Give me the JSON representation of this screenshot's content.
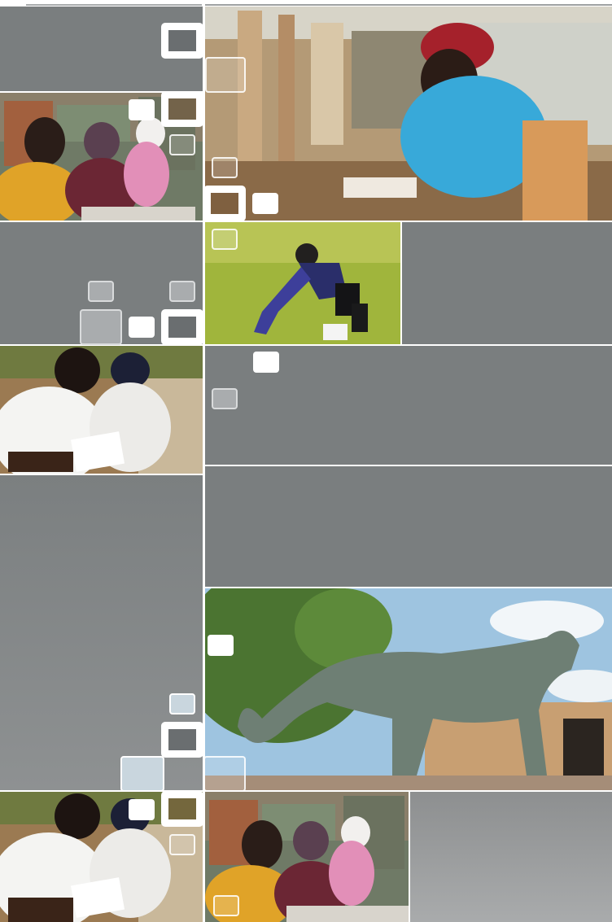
{
  "page": {
    "background": "#ffffff",
    "panel_grey": "#7a7e7f",
    "accent_white": "#ffffff"
  },
  "tiles": [
    {
      "id": "grey-top-left",
      "kind": "grey"
    },
    {
      "id": "library-students-reading",
      "kind": "photo",
      "icon": "photo-icon"
    },
    {
      "id": "library-student-desk",
      "kind": "photo",
      "icon": "photo-icon"
    },
    {
      "id": "athlete-stretching",
      "kind": "photo",
      "icon": "photo-icon"
    },
    {
      "id": "students-outdoor-study",
      "kind": "photo",
      "icon": "photo-icon"
    },
    {
      "id": "leopard-statue",
      "kind": "photo",
      "icon": "photo-icon"
    },
    {
      "id": "students-outdoor-study-bottom",
      "kind": "photo",
      "icon": "photo-icon"
    },
    {
      "id": "library-students-bottom",
      "kind": "photo",
      "icon": "photo-icon"
    }
  ]
}
